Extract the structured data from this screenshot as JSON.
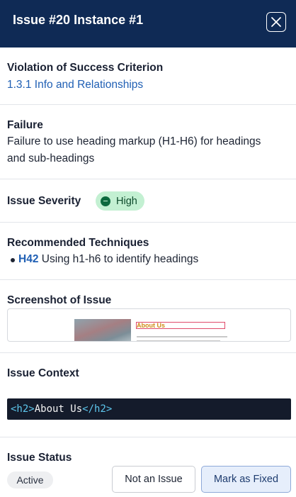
{
  "header": {
    "title": "Issue #20 Instance #1",
    "close_icon": "close-icon"
  },
  "violation": {
    "title": "Violation of Success Criterion",
    "criterion_link": "1.3.1 Info and Relationships"
  },
  "failure": {
    "title": "Failure",
    "line1": "Failure to use heading markup (H1-H6) for headings",
    "line2": "and sub-headings"
  },
  "severity": {
    "title": "Issue Severity",
    "badge": "High",
    "badge_icon": "minus-circle-icon",
    "badge_color": "#c3f0d2"
  },
  "techniques": {
    "title": "Recommended Techniques",
    "items": [
      {
        "code": "H42",
        "text": "Using h1-h6 to identify headings"
      }
    ]
  },
  "screenshot": {
    "title": "Screenshot of Issue",
    "heading_text": "About Us"
  },
  "context": {
    "title": "Issue Context",
    "code_open": "<h2>",
    "code_text": "About Us",
    "code_close": "</h2>"
  },
  "status": {
    "title": "Issue Status",
    "current": "Active",
    "not_issue_label": "Not an Issue",
    "mark_fixed_label": "Mark as Fixed"
  },
  "colors": {
    "header_bg": "#0f2a55",
    "link": "#1f5fb4",
    "code_bg": "#141b2b",
    "code_tag": "#5ec8ee"
  }
}
